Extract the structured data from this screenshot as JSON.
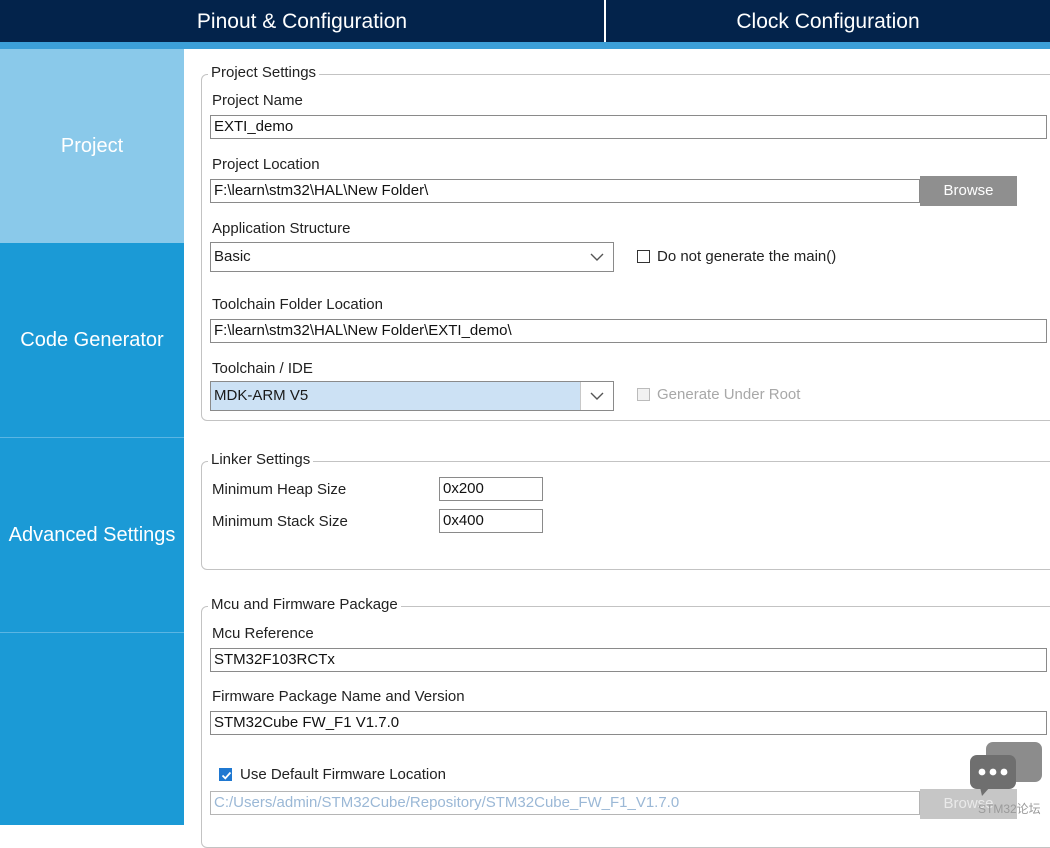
{
  "tabs": {
    "pinout": "Pinout & Configuration",
    "clock": "Clock Configuration"
  },
  "sidebar": {
    "items": [
      {
        "label": "Project"
      },
      {
        "label": "Code Generator"
      },
      {
        "label": "Advanced Settings"
      }
    ]
  },
  "project_settings": {
    "legend": "Project Settings",
    "project_name_label": "Project Name",
    "project_name": "EXTI_demo",
    "project_location_label": "Project Location",
    "project_location": "F:\\learn\\stm32\\HAL\\New Folder\\",
    "browse_label": "Browse",
    "app_structure_label": "Application Structure",
    "app_structure": "Basic",
    "no_main_label": "Do not generate the main()",
    "toolchain_folder_label": "Toolchain Folder Location",
    "toolchain_folder": "F:\\learn\\stm32\\HAL\\New Folder\\EXTI_demo\\",
    "toolchain_ide_label": "Toolchain / IDE",
    "toolchain_ide": "MDK-ARM V5",
    "generate_under_root_label": "Generate Under Root"
  },
  "linker_settings": {
    "legend": "Linker Settings",
    "heap_label": "Minimum Heap Size",
    "heap_value": "0x200",
    "stack_label": "Minimum Stack Size",
    "stack_value": "0x400"
  },
  "mcu_firmware": {
    "legend": "Mcu and Firmware Package",
    "mcu_ref_label": "Mcu Reference",
    "mcu_ref": "STM32F103RCTx",
    "fw_label": "Firmware Package Name and Version",
    "fw_value": "STM32Cube FW_F1 V1.7.0",
    "use_default_label": "Use Default Firmware Location",
    "use_default_checked": true,
    "fw_location": "C:/Users/admin/STM32Cube/Repository/STM32Cube_FW_F1_V1.7.0",
    "browse_label": "Browse"
  },
  "overlay": {
    "chat_icon": "chat-bubble-icon",
    "watermark": "STM32论坛"
  },
  "colors": {
    "topbar": "#03234b",
    "accent": "#3c9fd8",
    "sidebar": "#1b9ad6",
    "sidebar_active": "#8ac9ea"
  }
}
